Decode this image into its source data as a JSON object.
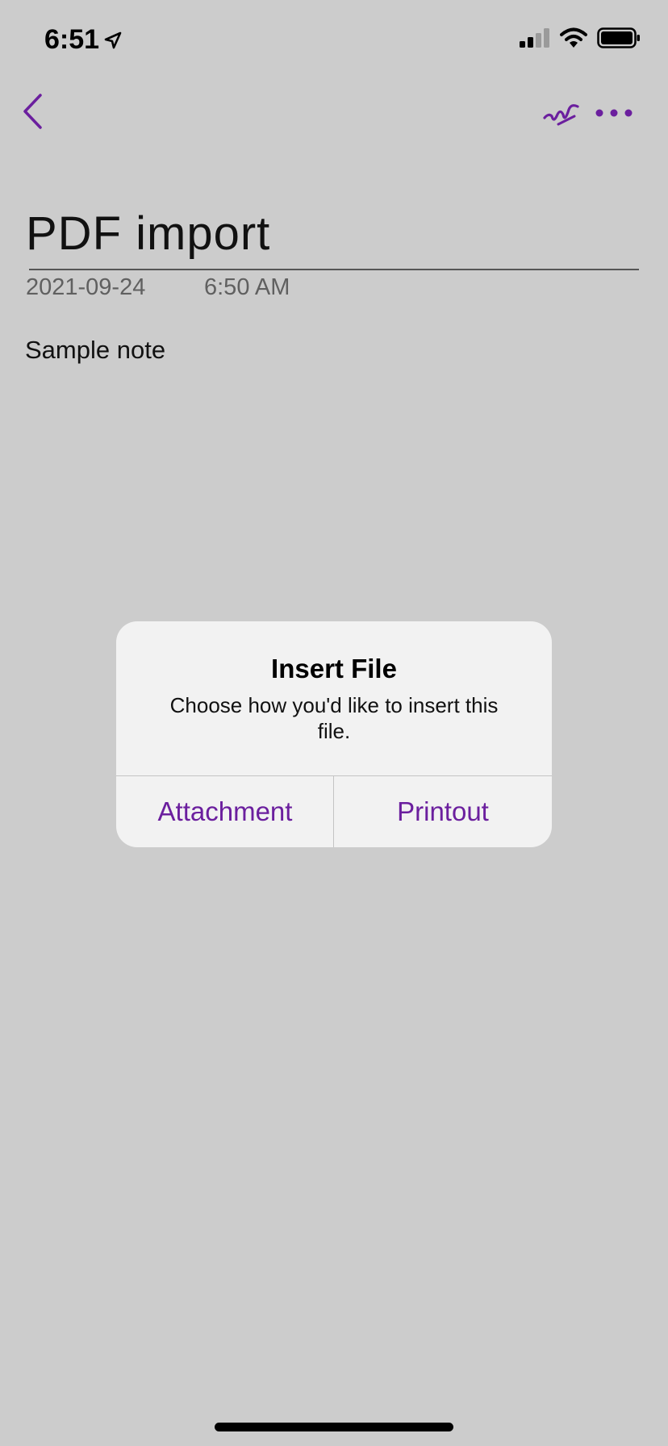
{
  "status_bar": {
    "time": "6:51",
    "location_icon": "location-arrow-icon",
    "signal_icon": "signal-bars-icon",
    "wifi_icon": "wifi-icon",
    "battery_icon": "battery-icon"
  },
  "nav": {
    "back_icon": "chevron-left-icon",
    "pen_icon": "ink-pen-icon",
    "more_icon": "more-dots-icon",
    "accent_color": "#6b1f9e"
  },
  "note": {
    "title": "PDF import",
    "date": "2021-09-24",
    "time": "6:50 AM",
    "body": "Sample note"
  },
  "alert": {
    "title": "Insert File",
    "message": "Choose how you'd like to insert this file.",
    "buttons": {
      "attachment": "Attachment",
      "printout": "Printout"
    }
  }
}
